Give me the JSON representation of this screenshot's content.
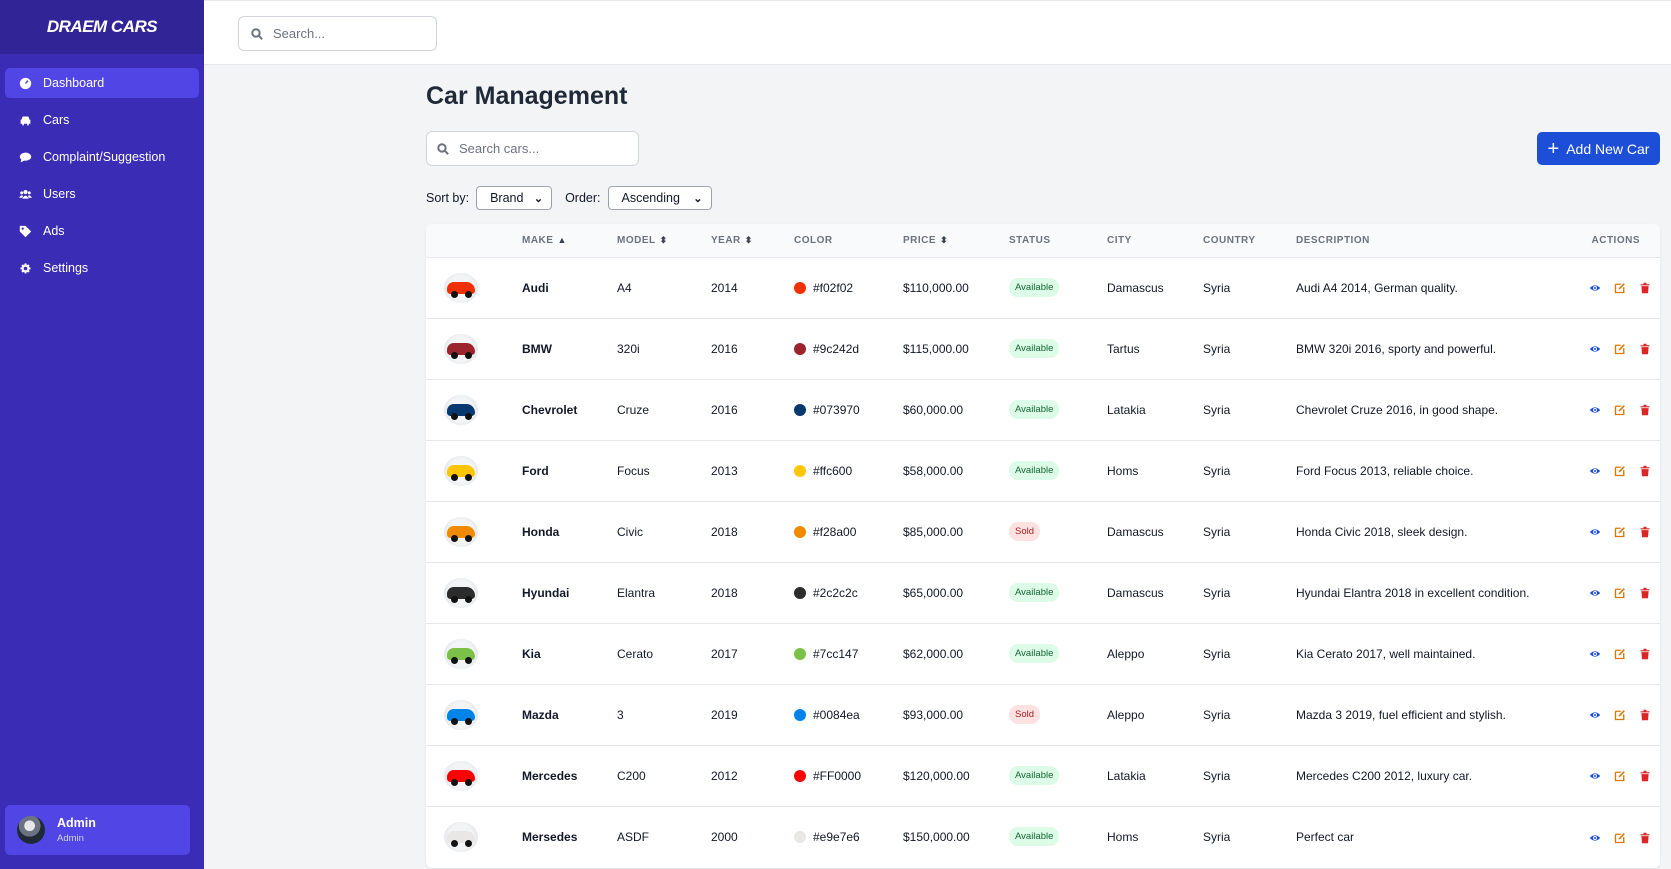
{
  "app": {
    "brand": "DRAEM CARS"
  },
  "sidebar": {
    "items": [
      {
        "label": "Dashboard",
        "icon": "dashboard-icon",
        "active": true
      },
      {
        "label": "Cars",
        "icon": "car-icon"
      },
      {
        "label": "Complaint/Suggestion",
        "icon": "comment-icon"
      },
      {
        "label": "Users",
        "icon": "users-icon"
      },
      {
        "label": "Ads",
        "icon": "tag-icon"
      },
      {
        "label": "Settings",
        "icon": "gear-icon"
      }
    ],
    "user": {
      "name": "Admin",
      "role": "Admin"
    }
  },
  "topbar": {
    "search_placeholder": "Search..."
  },
  "main": {
    "title": "Car Management",
    "search_placeholder": "Search cars...",
    "add_button": "Add New Car",
    "sort_label": "Sort by:",
    "sort_value": "Brand",
    "order_label": "Order:",
    "order_value": "Ascending"
  },
  "table": {
    "headers": {
      "make": "MAKE",
      "model": "MODEL",
      "year": "YEAR",
      "color": "COLOR",
      "price": "PRICE",
      "status": "STATUS",
      "city": "CITY",
      "country": "COUNTRY",
      "description": "DESCRIPTION",
      "actions": "ACTIONS"
    },
    "sort_indicators": {
      "make": "▲",
      "model": "⬍",
      "year": "⬍",
      "price": "⬍"
    },
    "rows": [
      {
        "make": "Audi",
        "model": "A4",
        "year": "2014",
        "color": "#f02f02",
        "price": "$110,000.00",
        "status": "Available",
        "city": "Damascus",
        "country": "Syria",
        "description": "Audi A4 2014, German quality."
      },
      {
        "make": "BMW",
        "model": "320i",
        "year": "2016",
        "color": "#9c242d",
        "price": "$115,000.00",
        "status": "Available",
        "city": "Tartus",
        "country": "Syria",
        "description": "BMW 320i 2016, sporty and powerful."
      },
      {
        "make": "Chevrolet",
        "model": "Cruze",
        "year": "2016",
        "color": "#073970",
        "price": "$60,000.00",
        "status": "Available",
        "city": "Latakia",
        "country": "Syria",
        "description": "Chevrolet Cruze 2016, in good shape."
      },
      {
        "make": "Ford",
        "model": "Focus",
        "year": "2013",
        "color": "#ffc600",
        "price": "$58,000.00",
        "status": "Available",
        "city": "Homs",
        "country": "Syria",
        "description": "Ford Focus 2013, reliable choice."
      },
      {
        "make": "Honda",
        "model": "Civic",
        "year": "2018",
        "color": "#f28a00",
        "price": "$85,000.00",
        "status": "Sold",
        "city": "Damascus",
        "country": "Syria",
        "description": "Honda Civic 2018, sleek design."
      },
      {
        "make": "Hyundai",
        "model": "Elantra",
        "year": "2018",
        "color": "#2c2c2c",
        "price": "$65,000.00",
        "status": "Available",
        "city": "Damascus",
        "country": "Syria",
        "description": "Hyundai Elantra 2018 in excellent condition."
      },
      {
        "make": "Kia",
        "model": "Cerato",
        "year": "2017",
        "color": "#7cc147",
        "price": "$62,000.00",
        "status": "Available",
        "city": "Aleppo",
        "country": "Syria",
        "description": "Kia Cerato 2017, well maintained."
      },
      {
        "make": "Mazda",
        "model": "3",
        "year": "2019",
        "color": "#0084ea",
        "price": "$93,000.00",
        "status": "Sold",
        "city": "Aleppo",
        "country": "Syria",
        "description": "Mazda 3 2019, fuel efficient and stylish."
      },
      {
        "make": "Mercedes",
        "model": "C200",
        "year": "2012",
        "color": "#FF0000",
        "price": "$120,000.00",
        "status": "Available",
        "city": "Latakia",
        "country": "Syria",
        "description": "Mercedes C200 2012, luxury car."
      },
      {
        "make": "Mersedes",
        "model": "ASDF",
        "year": "2000",
        "color": "#e9e7e6",
        "price": "$150,000.00",
        "status": "Available",
        "city": "Homs",
        "country": "Syria",
        "description": "Perfect car"
      }
    ]
  },
  "colors": {
    "sidebar": "#3b2cb5",
    "active": "#5146e5",
    "primary": "#1d4ed8",
    "view": "#1d4ed8",
    "edit": "#d97706",
    "delete": "#dc2626"
  }
}
